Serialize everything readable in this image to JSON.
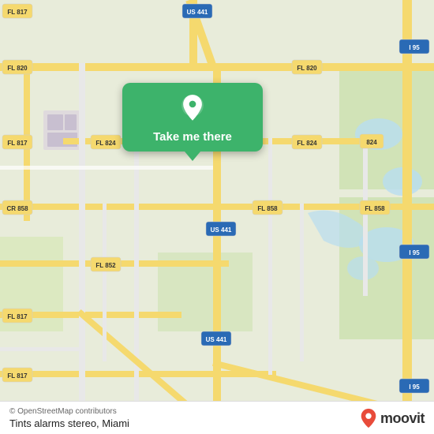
{
  "map": {
    "background_color": "#e8f0d8",
    "center_lat": 25.97,
    "center_lng": -80.28
  },
  "popup": {
    "label": "Take me there",
    "pin_icon": "location-pin-icon"
  },
  "bottom_bar": {
    "attribution": "© OpenStreetMap contributors",
    "place_name": "Tints alarms stereo, Miami",
    "logo_text": "moovit"
  },
  "road_labels": [
    {
      "id": "fl817_tl",
      "text": "FL 817"
    },
    {
      "id": "us441_t",
      "text": "US 441"
    },
    {
      "id": "fl820_l",
      "text": "FL 820"
    },
    {
      "id": "fl820_r",
      "text": "FL 820"
    },
    {
      "id": "i95_tr",
      "text": "I 95"
    },
    {
      "id": "fl817_ml",
      "text": "FL 817"
    },
    {
      "id": "fl824_m",
      "text": "FL 824"
    },
    {
      "id": "fl824_r",
      "text": "FL 824"
    },
    {
      "id": "fl858_m",
      "text": "FL 858"
    },
    {
      "id": "fl858_r",
      "text": "FL 858"
    },
    {
      "id": "i95_mr",
      "text": "I 95"
    },
    {
      "id": "cr858",
      "text": "CR 858"
    },
    {
      "id": "us441_m",
      "text": "US 441"
    },
    {
      "id": "fl852",
      "text": "FL 852"
    },
    {
      "id": "fl817_bl",
      "text": "FL 817"
    },
    {
      "id": "us441_b",
      "text": "US 441"
    },
    {
      "id": "fl817_bb",
      "text": "FL 817"
    },
    {
      "id": "i95_br",
      "text": "I 95"
    },
    {
      "id": "fl824_b",
      "text": "824"
    },
    {
      "id": "i95_btr",
      "text": "I 95"
    }
  ]
}
